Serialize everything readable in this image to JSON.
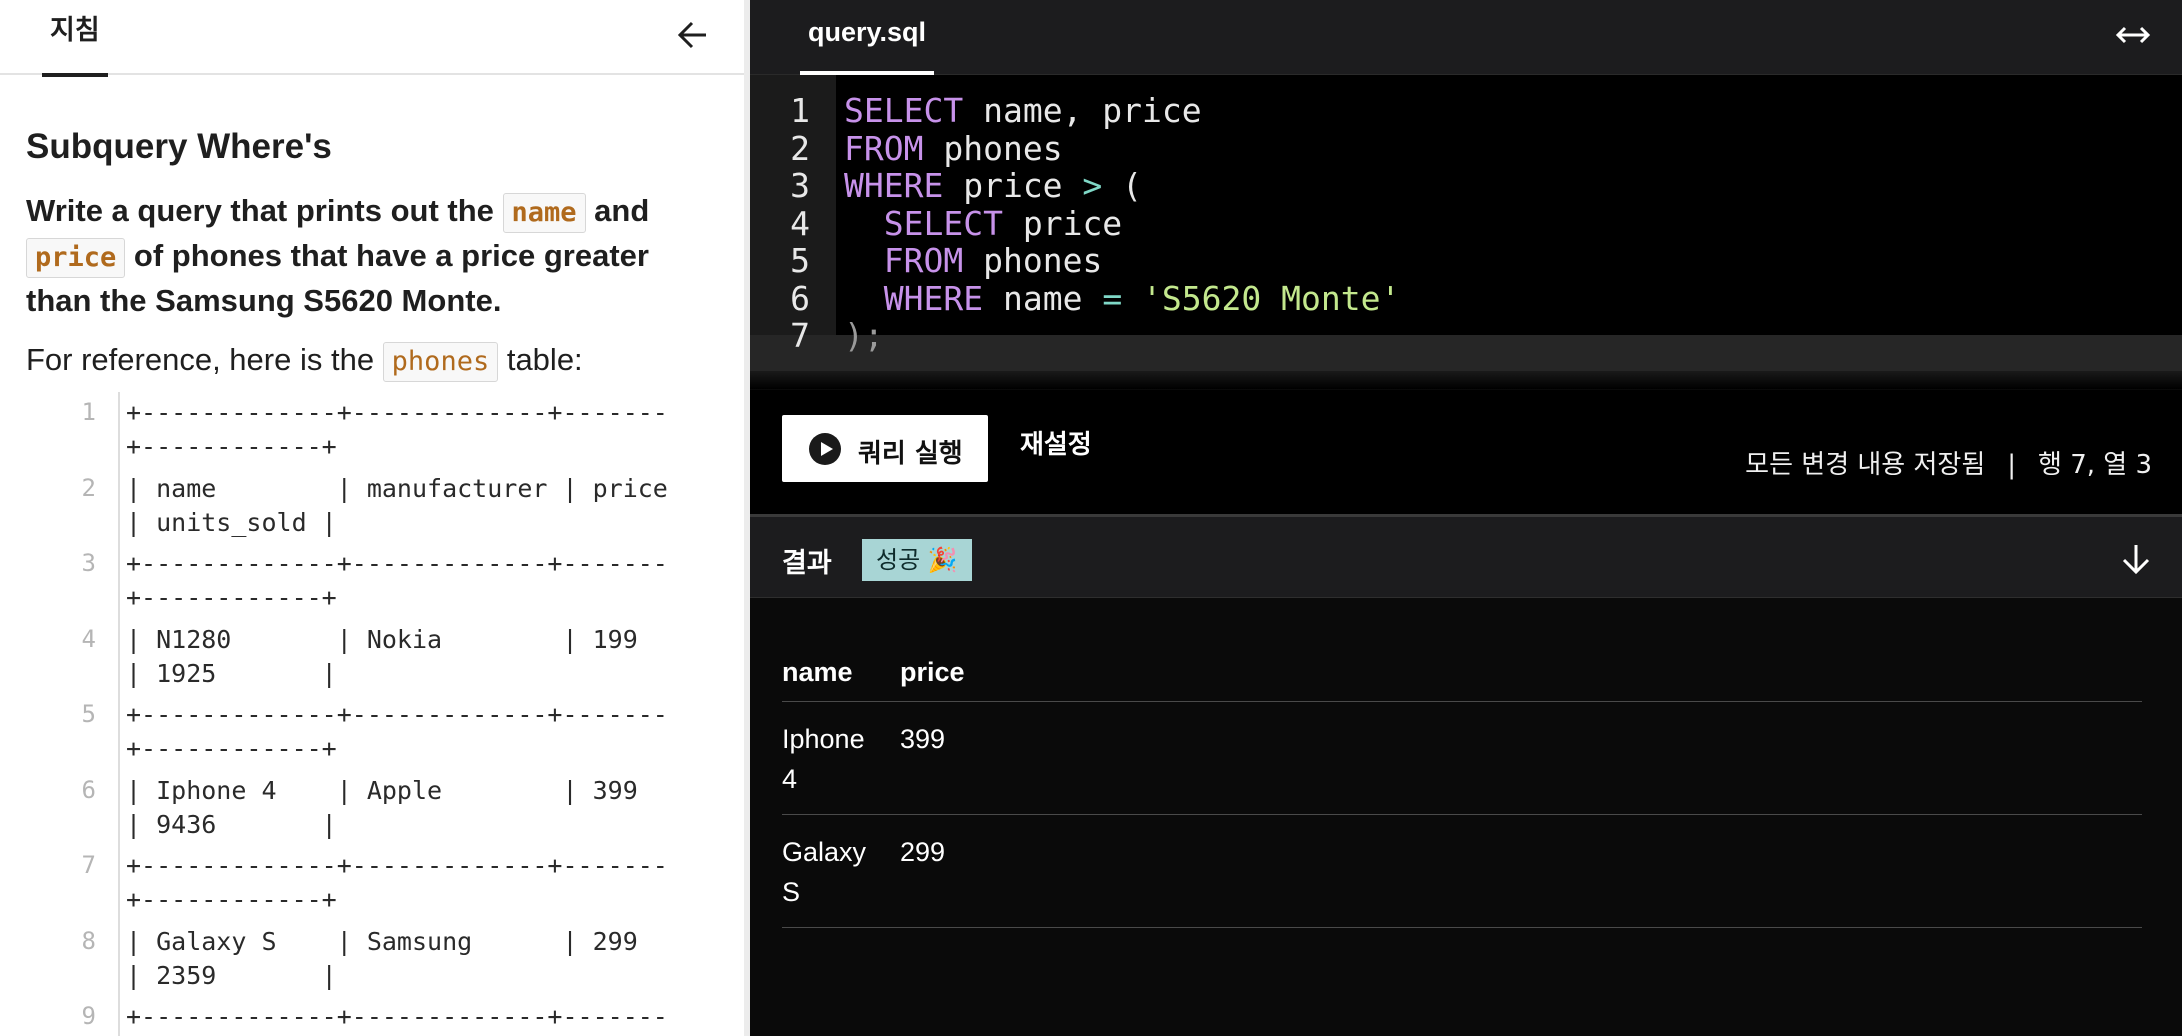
{
  "left_panel": {
    "tab_label": "지침",
    "title": "Subquery Where's",
    "instruction": {
      "part1": "Write a query that prints out the ",
      "chip1": "name",
      "part2": " and ",
      "chip2": "price",
      "part3": " of phones that have a price greater than the Samsung S5620 Monte."
    },
    "reference": {
      "before": "For reference, here is the ",
      "chip": "phones",
      "after": " table:"
    },
    "table_lines": [
      {
        "num": "1",
        "text": "+-------------+-------------+-------\n+------------+"
      },
      {
        "num": "2",
        "text": "| name        | manufacturer | price\n| units_sold |"
      },
      {
        "num": "3",
        "text": "+-------------+-------------+-------\n+------------+"
      },
      {
        "num": "4",
        "text": "| N1280       | Nokia        | 199\n| 1925       |"
      },
      {
        "num": "5",
        "text": "+-------------+-------------+-------\n+------------+"
      },
      {
        "num": "6",
        "text": "| Iphone 4    | Apple        | 399\n| 9436       |"
      },
      {
        "num": "7",
        "text": "+-------------+-------------+-------\n+------------+"
      },
      {
        "num": "8",
        "text": "| Galaxy S    | Samsung      | 299\n| 2359       |"
      },
      {
        "num": "9",
        "text": "+-------------+-------------+-------"
      }
    ]
  },
  "editor": {
    "file_tab": "query.sql",
    "lines": [
      {
        "num": "1",
        "html": "<span class=\"kw\">SELECT</span> name, price"
      },
      {
        "num": "2",
        "html": "<span class=\"kw\">FROM</span> phones"
      },
      {
        "num": "3",
        "html": "<span class=\"kw\">WHERE</span> price <span class=\"op\">&gt;</span> ("
      },
      {
        "num": "4",
        "html": "  <span class=\"kw\">SELECT</span> price"
      },
      {
        "num": "5",
        "html": "  <span class=\"kw\">FROM</span> phones"
      },
      {
        "num": "6",
        "html": "  <span class=\"kw\">WHERE</span> name <span class=\"op\">=</span> <span class=\"str\">'S5620 Monte'</span>"
      },
      {
        "num": "7",
        "html": "<span class=\"punc\">);</span>"
      }
    ]
  },
  "controls": {
    "run_label": "쿼리 실행",
    "reset_label": "재설정",
    "saved_status": "모든 변경 내용 저장됨",
    "separator": "|",
    "cursor_position": "행 7, 열 3"
  },
  "results": {
    "title": "결과",
    "badge": "성공 🎉",
    "columns": [
      "name",
      "price"
    ],
    "rows": [
      [
        "Iphone 4",
        "399"
      ],
      [
        "Galaxy S",
        "299"
      ]
    ]
  },
  "colors": {
    "keyword": "#c792ea",
    "operator": "#7fd8c7",
    "string": "#c3e88d",
    "badge_bg": "#a8d5d5",
    "chip_text": "#b06a1d"
  }
}
